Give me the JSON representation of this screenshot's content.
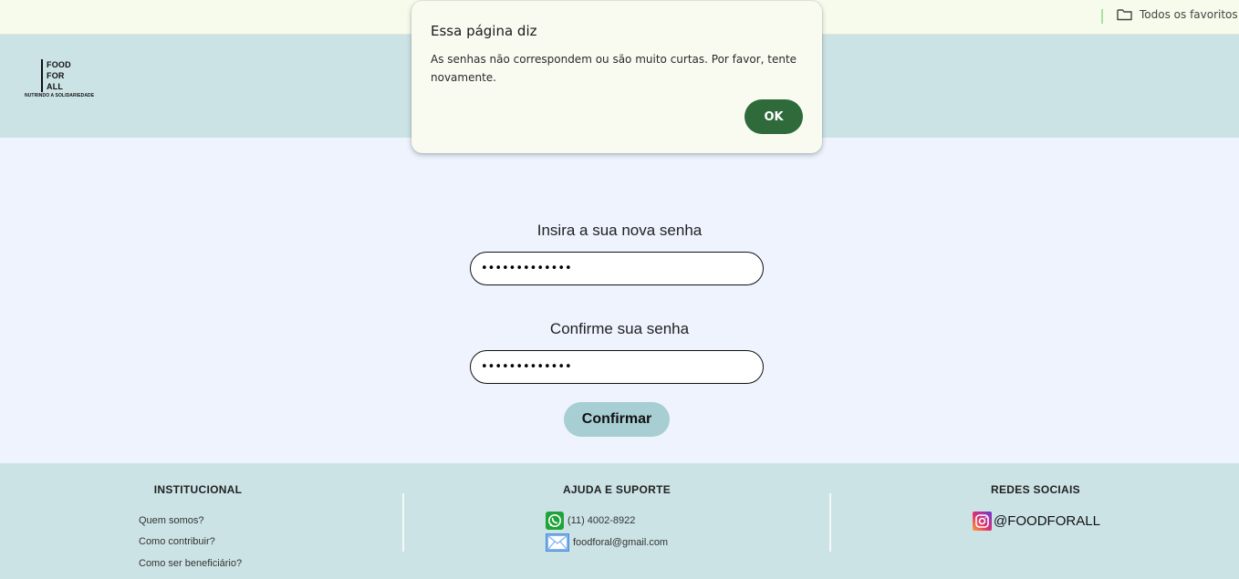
{
  "bookmarks": {
    "all_favorites_label": "Todos os favoritos",
    "icon": "folder-icon"
  },
  "header": {
    "logo": {
      "line1": "FOOD",
      "line2": "FOR",
      "line3": "ALL",
      "tagline": "NUTRINDO A SOLIDARIEDADE"
    }
  },
  "form": {
    "new_password_label": "Insira a sua nova senha",
    "new_password_value": "•••••••••••••",
    "confirm_password_label": "Confirme sua senha",
    "confirm_password_value": "•••••••••••••",
    "confirm_button": "Confirmar"
  },
  "footer": {
    "institutional": {
      "heading": "INSTITUCIONAL",
      "links": [
        "Quem somos?",
        "Como contribuir?",
        "Como ser beneficiário?"
      ]
    },
    "help": {
      "heading": "AJUDA E SUPORTE",
      "phone": "(11) 4002-8922",
      "email": "foodforal@gmail.com",
      "phone_icon": "whatsapp-icon",
      "email_icon": "mail-icon"
    },
    "social": {
      "heading": "REDES SOCIAIS",
      "instagram": "@FOODFORALL",
      "icon": "instagram-icon"
    }
  },
  "dialog": {
    "title": "Essa página diz",
    "message": "As senhas não correspondem ou são muito curtas. Por favor, tente novamente.",
    "ok_label": "OK"
  },
  "colors": {
    "header_bg": "#cce3e6",
    "main_bg": "#eef3fe",
    "confirm_button_bg": "#a6ced3",
    "dialog_ok_bg": "#2f6a3b",
    "dialog_bg": "#f9fbf1"
  }
}
